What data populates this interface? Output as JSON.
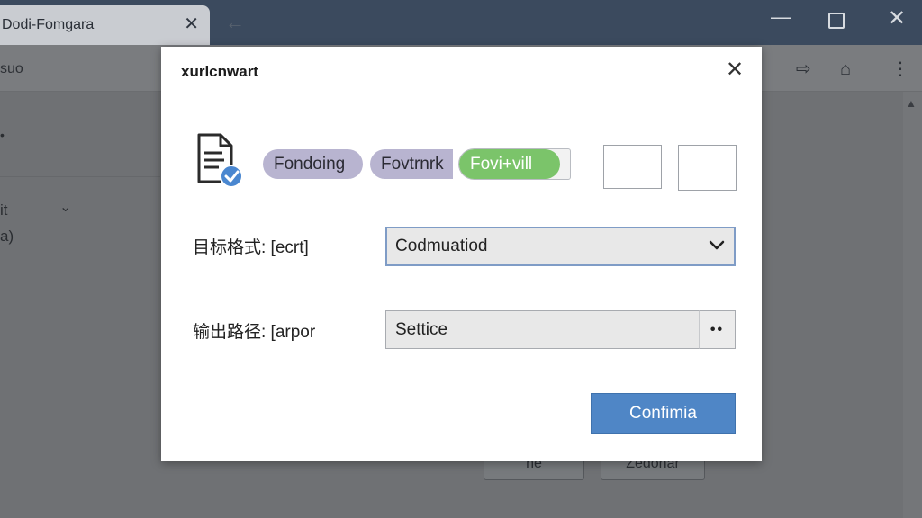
{
  "background": {
    "tab_title": "Dodi-Fomgara",
    "toolbar_label": "suo",
    "sidebar_text_1": "it",
    "sidebar_text_2": "a)",
    "button_1": "ne",
    "button_2": "Zedonar"
  },
  "dialog": {
    "title": "xurlcnwart",
    "chips": [
      {
        "label": "Fondoing"
      },
      {
        "label": "Fovtrnrk"
      },
      {
        "label": "Fovi+vill"
      }
    ],
    "format_label": "目标格式: [ecrt]",
    "format_value": "Codmuatiod",
    "output_label": "输出路径: [arpor",
    "output_value": "Settice",
    "browse_label": "••",
    "confirm_label": "Confimia"
  },
  "colors": {
    "accent": "#4f86c6",
    "chip_purple": "#b8b4d0",
    "chip_green": "#7bc46a"
  }
}
